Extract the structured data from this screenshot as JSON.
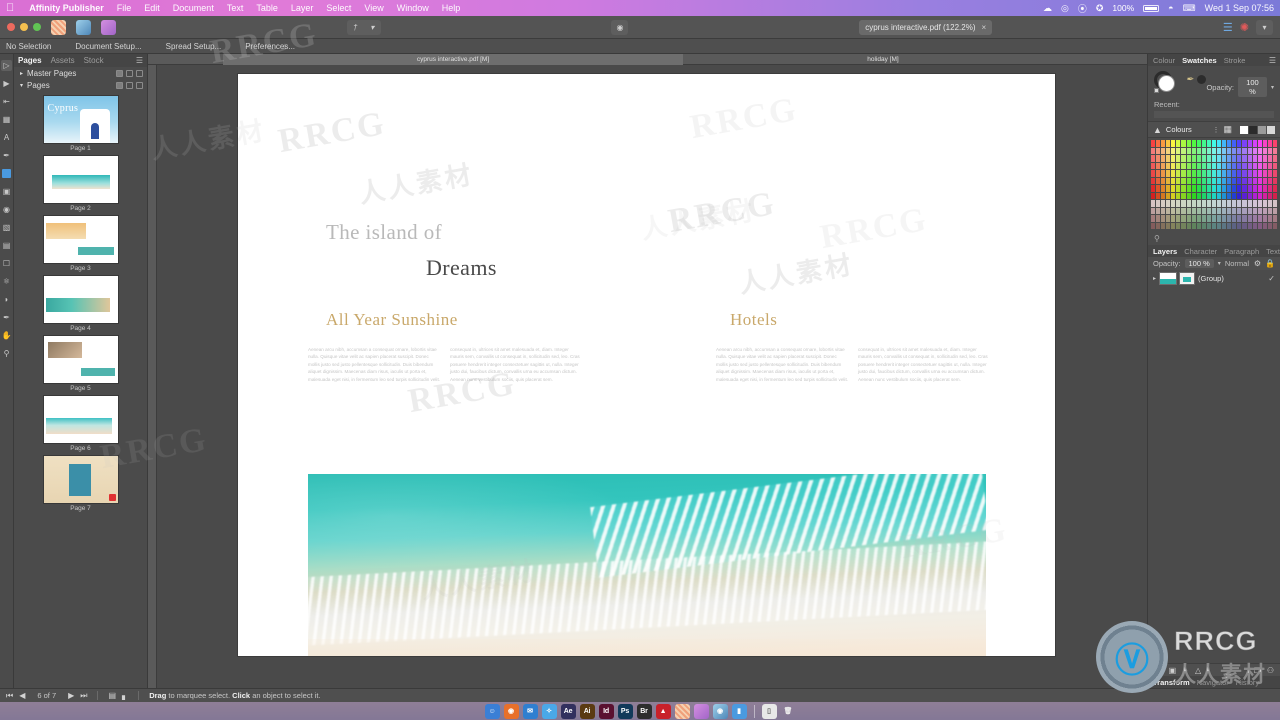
{
  "menubar": {
    "apple_icon": "apple-icon",
    "app_name": "Affinity Publisher",
    "items": [
      "File",
      "Edit",
      "Document",
      "Text",
      "Table",
      "Layer",
      "Select",
      "View",
      "Window",
      "Help"
    ],
    "battery_percent": "100%",
    "clock": "Wed 1 Sep  07:56",
    "status_icons": [
      "cloud-icon",
      "screen-share-icon",
      "dropbox-icon",
      "bluetooth-icon",
      "wifi-icon",
      "input-source-icon"
    ]
  },
  "toolbar": {
    "traffic_lights": [
      "close",
      "minimize",
      "zoom"
    ],
    "personas": [
      "publisher-persona",
      "photo-persona",
      "designer-persona"
    ],
    "document_tab": "cyprus interactive.pdf (122.2%)",
    "document_tab_close": "×"
  },
  "context_bar": {
    "items": [
      "No Selection",
      "Document Setup...",
      "Spread Setup...",
      "Preferences..."
    ]
  },
  "tools": {
    "items": [
      "move-tool",
      "node-tool",
      "text-frame-tool",
      "table-tool",
      "artistic-text-tool",
      "pen-tool",
      "rectangle-tool",
      "picture-frame-tool",
      "ellipse-tool",
      "place-image-tool",
      "crop-tool",
      "transform-tool",
      "colour-picker-tool",
      "fill-tool",
      "eyedropper-tool",
      "view-tool",
      "zoom-tool"
    ]
  },
  "pages_panel": {
    "tabs": [
      "Pages",
      "Assets",
      "Stock"
    ],
    "active_tab": "Pages",
    "sections": [
      {
        "label": "Master Pages"
      },
      {
        "label": "Pages"
      }
    ],
    "thumbnails": [
      {
        "caption": "Page 1",
        "art": "t1",
        "title": "Cyprus"
      },
      {
        "caption": "Page 2",
        "art": "t2"
      },
      {
        "caption": "Page 3",
        "art": "t3"
      },
      {
        "caption": "Page 4",
        "art": "t4"
      },
      {
        "caption": "Page 5",
        "art": "t5"
      },
      {
        "caption": "Page 6",
        "art": "t6"
      },
      {
        "caption": "Page 7",
        "art": "t7"
      }
    ]
  },
  "ruler": {
    "left_label": "cyprus interactive.pdf [M]",
    "right_label": "holiday [M]"
  },
  "document": {
    "heading_small": "The island of",
    "heading_large": "Dreams",
    "section_left": "All Year Sunshine",
    "section_right": "Hotels",
    "body_col1": "Aenean arcu nibh, accumsan a consequat ornare, lobortis vitae nulla. Quisque vitae velit ac sapien placerat suscipit. Donec mollis justo sed justo pellentesque sollicitudin. Duis bibendum aliquet dignissim. Maecenas diam risus, iaculis ut porta et, malesuada eget nisi, in fermentum leo sed turpis sollicitudin velit.",
    "body_col2": "consequat in, ultrices sit amet malesuada et, diam. Integer mauris sem, convallis ut consequat in, sollicitudin sed, leo. Cras posuere hendrerit integer consectetuer sagittis ut, nulla. Integer justo dui, faucibus dictum, convallis urna eu accumsan dictum. Aenean nunc vestibulum sociis, quis placerat sem.",
    "body_col3": "Aenean arcu nibh, accumsan a consequat ornare, lobortis vitae nulla. Quisque vitae velit ac sapien placerat suscipit. Donec mollis justo sed justo pellentesque sollicitudin. Duis bibendum aliquet dignissim. Maecenas diam risus, iaculis ut porta et, malesuada eget nisi, in fermentum leo sed turpis sollicitudin velit.",
    "body_col4": "consequat in, ultrices sit amet malesuada et, diam. Integer mauris sem, convallis ut consequat in, sollicitudin sed, leo. Cras posuere hendrerit integer consectetuer sagittis ut, nulla. Integer justo dui, faucibus dictum, convallis urna eu accumsan dictum. Aenean nunc vestibulum sociis, quis placerat sem.",
    "hero_image": "aerial-beach-photo",
    "accent_colour": "#c9a86a"
  },
  "colour_panel": {
    "tabs": [
      "Colour",
      "Swatches",
      "Stroke"
    ],
    "active_tab": "Swatches",
    "opacity_label": "Opacity:",
    "opacity_value": "100 %",
    "recent_label": "Recent:",
    "palette_name": "Colours"
  },
  "layers_panel": {
    "tabs": [
      "Layers",
      "Character",
      "Paragraph",
      "Text Styles"
    ],
    "active_tab": "Layers",
    "opacity_label": "Opacity:",
    "opacity_value": "100 %",
    "blend_mode": "Normal",
    "rows": [
      {
        "name": "(Group)"
      }
    ]
  },
  "bottom_panel": {
    "tabs": [
      "Transform",
      "Navigator",
      "History"
    ],
    "active_tab": "Transform"
  },
  "statusbar": {
    "page_indicator": "6 of 7",
    "hint_bold_1": "Drag",
    "hint_text_1": " to marquee select. ",
    "hint_bold_2": "Click",
    "hint_text_2": " an object to select it."
  },
  "dock": {
    "items": [
      {
        "label": "",
        "name": "finder-icon",
        "color": "#3a7fd5"
      },
      {
        "label": "",
        "name": "firefox-icon",
        "color": "#e8702a"
      },
      {
        "label": "",
        "name": "mail-icon",
        "color": "#2f7fd0"
      },
      {
        "label": "",
        "name": "safari-icon",
        "color": "#4aa8e8"
      },
      {
        "label": "Ae",
        "name": "after-effects-icon",
        "color": "#32305e"
      },
      {
        "label": "Ai",
        "name": "illustrator-icon",
        "color": "#5a3a12"
      },
      {
        "label": "Id",
        "name": "indesign-icon",
        "color": "#5a1030"
      },
      {
        "label": "Ps",
        "name": "photoshop-icon",
        "color": "#123a5a"
      },
      {
        "label": "Br",
        "name": "bridge-icon",
        "color": "#2d2d2d"
      },
      {
        "label": "",
        "name": "acrobat-icon",
        "color": "#c8202a"
      },
      {
        "label": "",
        "name": "affinity-publisher-icon",
        "color": "#e09a5a"
      },
      {
        "label": "",
        "name": "affinity-designer-icon",
        "color": "#b06ad0"
      },
      {
        "label": "",
        "name": "affinity-photo-icon",
        "color": "#3a6a8a"
      },
      {
        "label": "",
        "name": "preview-icon",
        "color": "#4a9ae0"
      }
    ],
    "trash": "trash-icon",
    "documents_stack": "documents-stack-icon"
  },
  "watermarks": {
    "brand": "RRCG",
    "brand_cn": "人人素材",
    "tiles": [
      "RRCG",
      "人人素材"
    ]
  }
}
